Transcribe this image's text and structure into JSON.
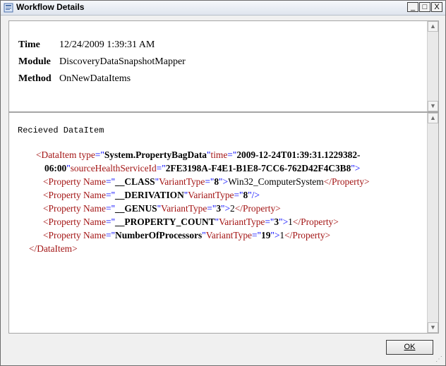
{
  "window": {
    "title": "Workflow Details",
    "controls": {
      "minimize": "_",
      "maximize": "□",
      "close": "X"
    }
  },
  "summary": {
    "time_label": "Time",
    "time_value": "12/24/2009 1:39:31 AM",
    "module_label": "Module",
    "module_value": "DiscoveryDataSnapshotMapper",
    "method_label": "Method",
    "method_value": "OnNewDataItems"
  },
  "details": {
    "heading": "Recieved DataItem",
    "xml": {
      "root_open": {
        "tag": "<DataItem",
        "attrs": [
          {
            "name": "type",
            "value": "System.PropertyBagData"
          },
          {
            "name": "time",
            "value": "2009-12-24T01:39:31.1229382-"
          },
          {
            "name": "sourceHealthServiceId",
            "value": "2FE3198A-F4E1-B1E8-7CC6-762D42F4C3B8"
          }
        ],
        "time_continuation": "06:00"
      },
      "properties": [
        {
          "name": "__CLASS",
          "variant": "8",
          "value": "Win32_ComputerSystem",
          "selfclosing": false
        },
        {
          "name": "__DERIVATION",
          "variant": "8",
          "value": "",
          "selfclosing": true
        },
        {
          "name": "__GENUS",
          "variant": "3",
          "value": "2",
          "selfclosing": false
        },
        {
          "name": "__PROPERTY_COUNT",
          "variant": "3",
          "value": "1",
          "selfclosing": false
        },
        {
          "name": "NumberOfProcessors",
          "variant": "19",
          "value": "1",
          "selfclosing": false
        }
      ],
      "root_close": "</DataItem>"
    }
  },
  "buttons": {
    "ok": "OK"
  }
}
